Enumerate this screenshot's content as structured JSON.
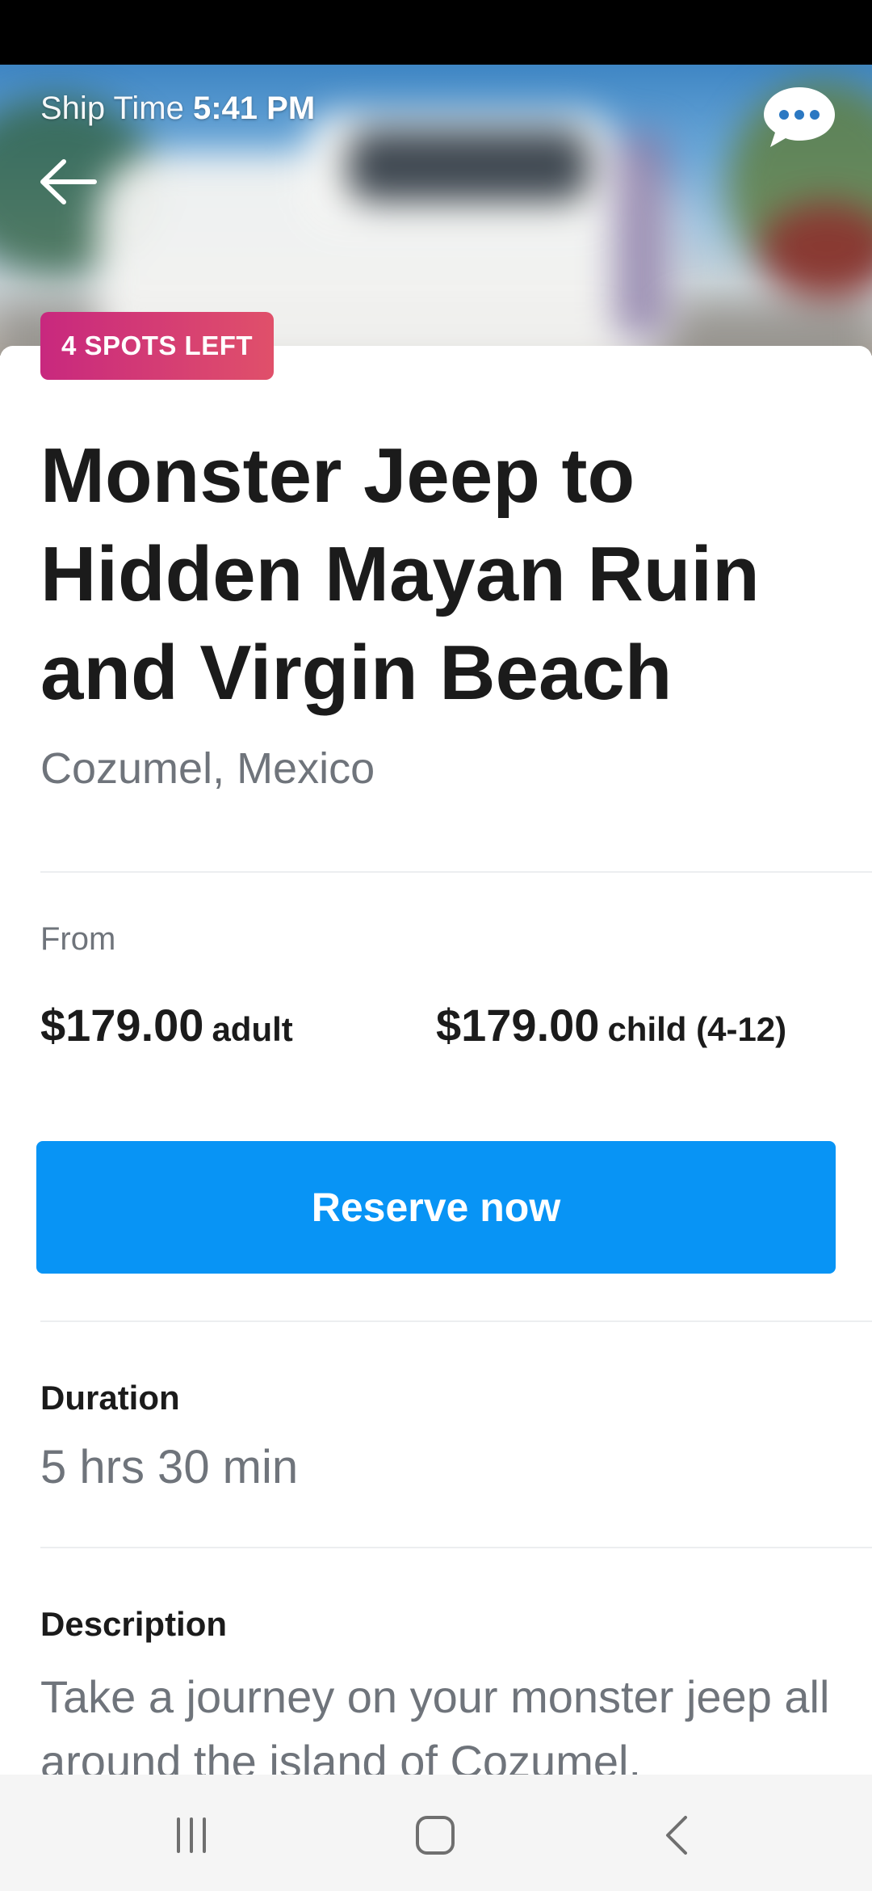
{
  "header": {
    "ship_time_label": "Ship Time",
    "ship_time_value": "5:41 PM",
    "back_icon": "arrow-left-icon",
    "chat_icon": "chat-bubble-icon"
  },
  "badge": {
    "text": "4 SPOTS LEFT",
    "gradient_start": "#c8287e",
    "gradient_end": "#e0506a"
  },
  "tour": {
    "title": "Monster Jeep to Hidden Mayan Ruin and Virgin Beach",
    "location": "Cozumel, Mexico"
  },
  "pricing": {
    "from_label": "From",
    "adult_price": "$179.00",
    "adult_unit": "adult",
    "child_price": "$179.00",
    "child_unit": "child (4-12)"
  },
  "cta": {
    "reserve_label": "Reserve now",
    "color": "#0894f5"
  },
  "duration": {
    "label": "Duration",
    "value": "5 hrs 30 min"
  },
  "description": {
    "label": "Description",
    "text": "Take a journey on your monster jeep all around the island of Cozumel."
  },
  "system_nav": {
    "recents_icon": "recents-icon",
    "home_icon": "home-icon",
    "back_icon": "back-chevron-icon"
  }
}
